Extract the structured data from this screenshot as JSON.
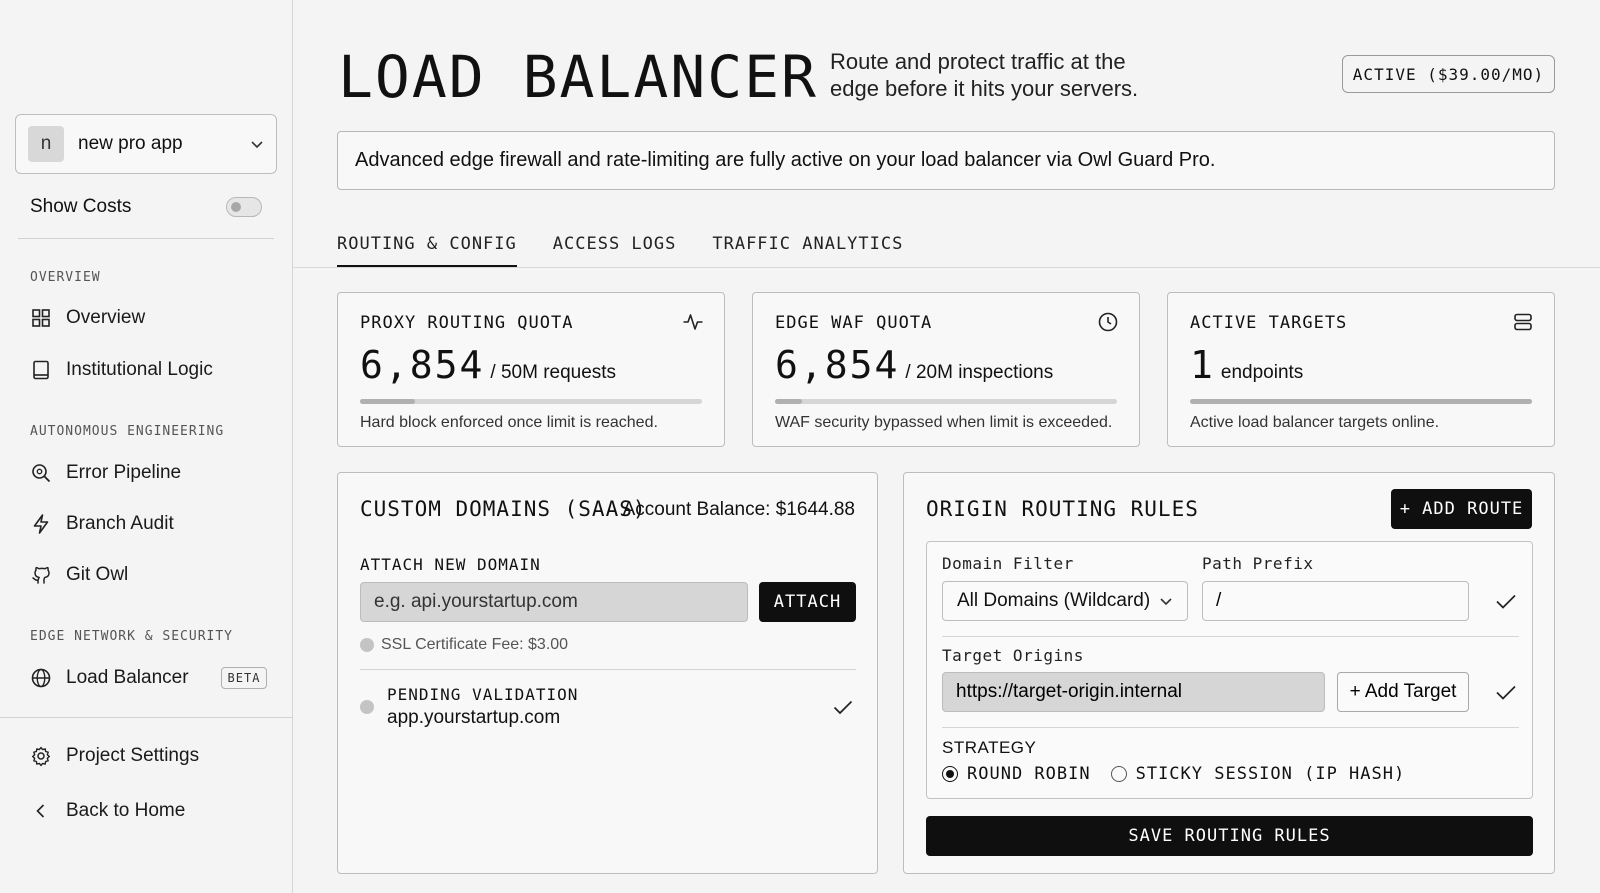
{
  "sidebar": {
    "project": {
      "avatar_letter": "n",
      "name": "new pro app"
    },
    "show_costs": {
      "label": "Show Costs",
      "enabled": false
    },
    "sections": [
      {
        "title": "OVERVIEW",
        "items": [
          {
            "label": "Overview",
            "icon": "grid-icon"
          },
          {
            "label": "Institutional Logic",
            "icon": "book-icon"
          }
        ]
      },
      {
        "title": "AUTONOMOUS ENGINEERING",
        "items": [
          {
            "label": "Error Pipeline",
            "icon": "search-bug-icon"
          },
          {
            "label": "Branch Audit",
            "icon": "bolt-icon"
          },
          {
            "label": "Git Owl",
            "icon": "github-icon"
          }
        ]
      },
      {
        "title": "EDGE NETWORK & SECURITY",
        "items": [
          {
            "label": "Load Balancer",
            "icon": "globe-icon",
            "badge": "BETA"
          }
        ]
      }
    ],
    "footer": [
      {
        "label": "Project Settings",
        "icon": "gear-icon"
      },
      {
        "label": "Back to Home",
        "icon": "chevron-left-icon"
      }
    ]
  },
  "header": {
    "title": "LOAD BALANCER",
    "subtitle_line1": "Route and protect traffic at the",
    "subtitle_line2": "edge before it hits your servers.",
    "status": "ACTIVE ($39.00/MO)"
  },
  "banner": "Advanced edge firewall and rate-limiting are fully active on your load balancer via Owl Guard Pro.",
  "tabs": [
    {
      "label": "ROUTING & CONFIG",
      "active": true
    },
    {
      "label": "ACCESS LOGS",
      "active": false
    },
    {
      "label": "TRAFFIC ANALYTICS",
      "active": false
    }
  ],
  "quotas": [
    {
      "label": "PROXY ROUTING QUOTA",
      "value": "6,854",
      "unit": "/ 50M requests",
      "fill": 0.16,
      "note": "Hard block enforced once limit is reached.",
      "icon": "activity-icon"
    },
    {
      "label": "EDGE WAF QUOTA",
      "value": "6,854",
      "unit": "/ 20M inspections",
      "fill": 0.08,
      "note": "WAF security bypassed when limit is exceeded.",
      "icon": "clock-icon"
    },
    {
      "label": "ACTIVE TARGETS",
      "value": "1",
      "unit": "endpoints",
      "fill": 1.0,
      "note": "Active load balancer targets online.",
      "icon": "server-icon"
    }
  ],
  "domains": {
    "title": "CUSTOM DOMAINS (SAAS)",
    "balance": "Account Balance: $1644.88",
    "attach_label": "ATTACH NEW DOMAIN",
    "input_placeholder": "e.g. api.yourstartup.com",
    "attach_button": "ATTACH",
    "fee": "SSL Certificate Fee: $3.00",
    "entries": [
      {
        "status": "PENDING VALIDATION",
        "host": "app.yourstartup.com"
      }
    ]
  },
  "routing": {
    "title": "ORIGIN ROUTING RULES",
    "add_button": "+ ADD ROUTE",
    "domain_filter_label": "Domain Filter",
    "domain_filter_value": "All Domains (Wildcard)",
    "path_prefix_label": "Path Prefix",
    "path_prefix_value": "/",
    "target_origins_label": "Target Origins",
    "target_origin_value": "https://target-origin.internal",
    "add_target_button": "+ Add Target",
    "strategy_label": "STRATEGY",
    "strategies": [
      {
        "label": "ROUND ROBIN",
        "selected": true
      },
      {
        "label": "STICKY SESSION (IP HASH)",
        "selected": false
      }
    ],
    "save_button": "SAVE ROUTING RULES"
  }
}
